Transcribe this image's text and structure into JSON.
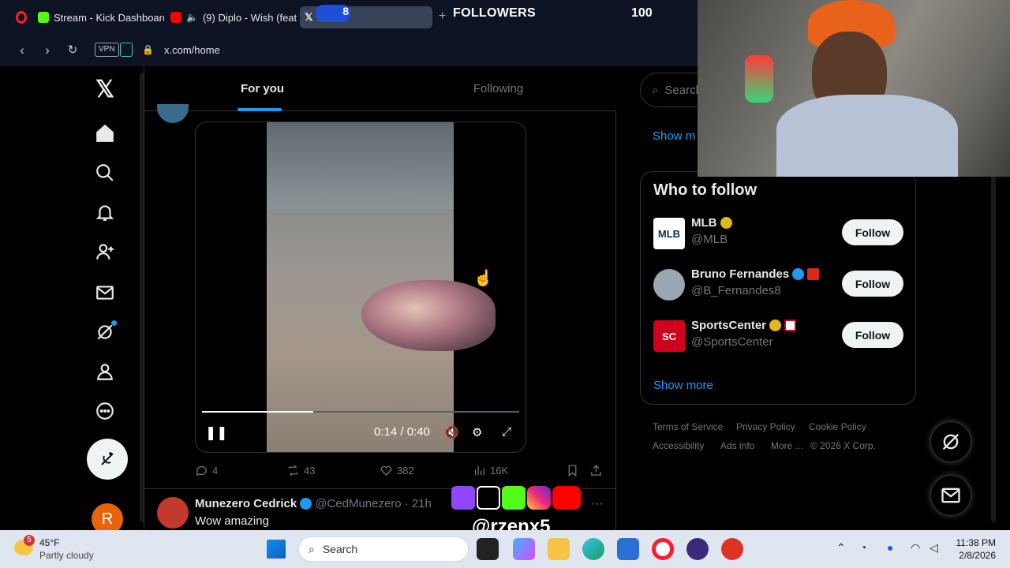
{
  "browser": {
    "tabs": [
      {
        "label": "Stream - Kick Dashboard",
        "color": "#53fc18"
      },
      {
        "label": "(9) Diplo - Wish (feat.",
        "color": "#ff0000"
      },
      {
        "label": "X",
        "color": "#ffffff"
      }
    ],
    "url": "x.com/home",
    "vpn_label": "VPN"
  },
  "overlay": {
    "followers_label": "FOLLOWERS",
    "followers_count": "100",
    "tab_counter": "8",
    "handle": "@rzenx5"
  },
  "feed": {
    "tabs": [
      {
        "label": "For you",
        "active": true
      },
      {
        "label": "Following",
        "active": false
      }
    ],
    "video": {
      "time": "0:14 / 0:40",
      "progress": 0.35
    },
    "actions": {
      "replies": "4",
      "reposts": "43",
      "likes": "382",
      "views": "16K"
    },
    "next_post": {
      "name": "Munezero Cedrick",
      "handle": "@CedMunezero",
      "time": "· 21h",
      "text": "Wow amazing"
    }
  },
  "sidebar": {
    "search_placeholder": "Search",
    "show_more_top": "Show m",
    "who_to_follow_title": "Who to follow",
    "accounts": [
      {
        "name": "MLB",
        "handle": "@MLB",
        "button": "Follow",
        "badge_color": "#e2b719"
      },
      {
        "name": "Bruno Fernandes",
        "handle": "@B_Fernandes8",
        "button": "Follow",
        "badge_color": "#1d9bf0"
      },
      {
        "name": "SportsCenter",
        "handle": "@SportsCenter",
        "button": "Follow",
        "badge_color": "#e2b719"
      }
    ],
    "show_more": "Show more",
    "footer": {
      "terms": "Terms of Service",
      "privacy": "Privacy Policy",
      "cookie": "Cookie Policy",
      "accessibility": "Accessibility",
      "ads": "Ads info",
      "more": "More ...",
      "copyright": "© 2026 X Corp."
    }
  },
  "nav": {
    "avatar_letter": "R"
  },
  "taskbar": {
    "weather_temp": "45°F",
    "weather_desc": "Partly cloudy",
    "weather_badge": "5",
    "search_label": "Search",
    "time": "11:38 PM",
    "date": "2/8/2026"
  }
}
